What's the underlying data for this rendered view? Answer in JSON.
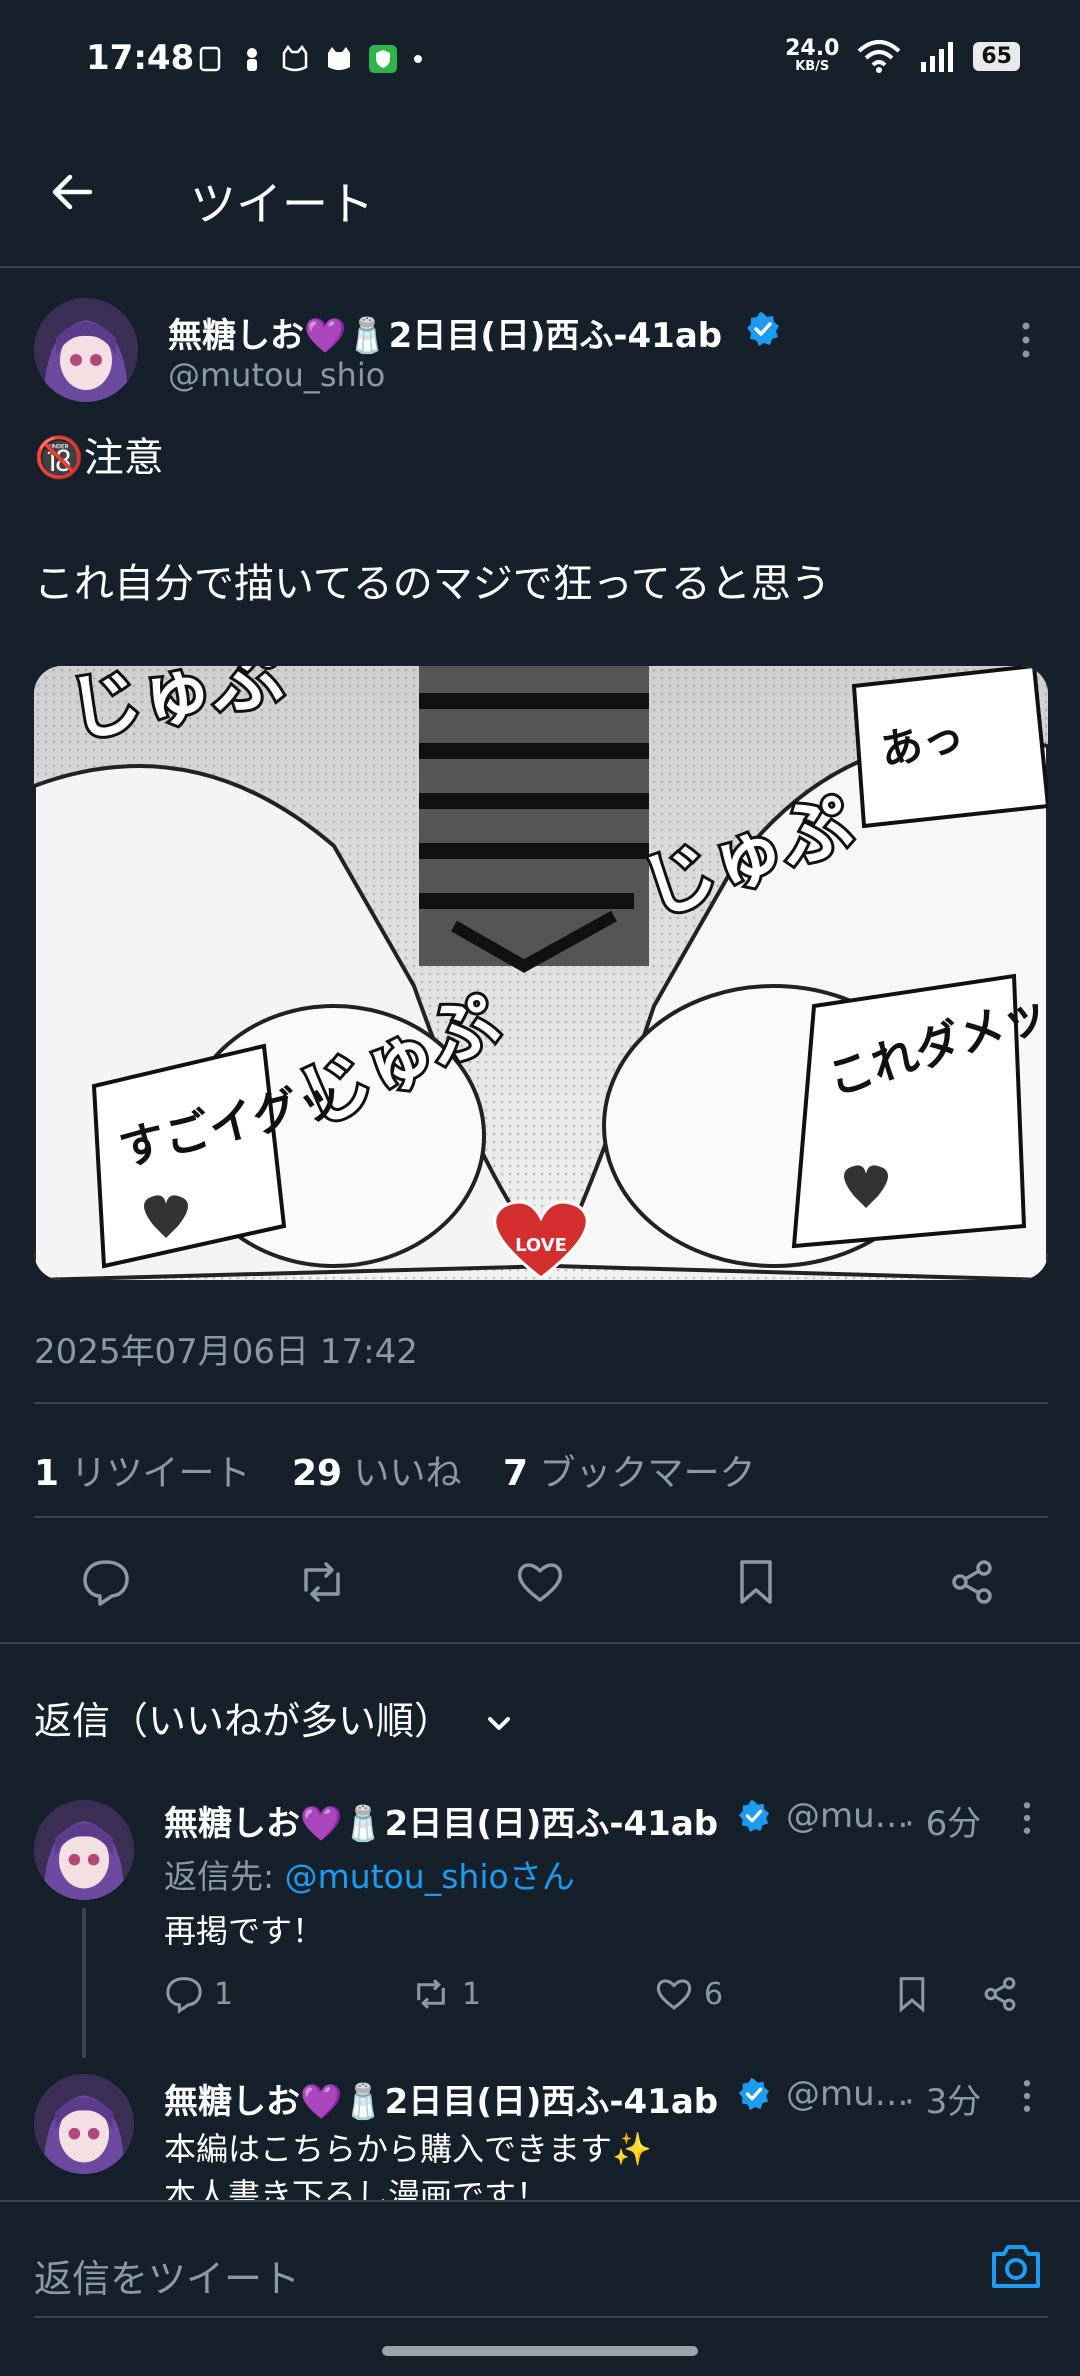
{
  "status_bar": {
    "time": "17:48",
    "net_speed_value": "24.0",
    "net_speed_unit": "KB/S",
    "battery": "65"
  },
  "header": {
    "title": "ツイート"
  },
  "tweet": {
    "author_name": "無糖しお💜🧂2日目(日)西ふ-41ab",
    "author_handle": "@mutou_shio",
    "text_line1": "🔞注意",
    "text_line2": "これ自分で描いてるのマジで狂ってると思う",
    "media_texts": [
      "じゅぷ",
      "じゅぷ",
      "じゅぷ",
      "すごイグッ",
      "これダメッ",
      "あっ",
      "LOVE"
    ],
    "timestamp": "2025年07月06日 17:42",
    "stats": {
      "retweets_count": "1",
      "retweets_label": "リツイート",
      "likes_count": "29",
      "likes_label": "いいね",
      "bookmarks_count": "7",
      "bookmarks_label": "ブックマーク"
    }
  },
  "replies_section": {
    "sort_label": "返信（いいねが多い順）"
  },
  "replies": [
    {
      "name": "無糖しお💜🧂2日目(日)西ふ-41ab",
      "handle": "@mu…",
      "time": "· 6分",
      "reply_to_prefix": "返信先: ",
      "reply_to_handle": "@mutou_shio",
      "reply_to_suffix": "さん",
      "body": "再掲です！",
      "reply_count": "1",
      "retweet_count": "1",
      "like_count": "6"
    },
    {
      "name": "無糖しお💜🧂2日目(日)西ふ-41ab",
      "handle": "@mu…",
      "time": "· 3分",
      "body_line1": "本編はこちらから購入できます✨",
      "body_line2": "本人書き下ろし漫画です！"
    }
  ],
  "composer": {
    "placeholder": "返信をツイート"
  },
  "colors": {
    "background": "#15202b",
    "accent": "#1d9bf0",
    "muted": "#8b98a5",
    "divider": "#38444d"
  }
}
